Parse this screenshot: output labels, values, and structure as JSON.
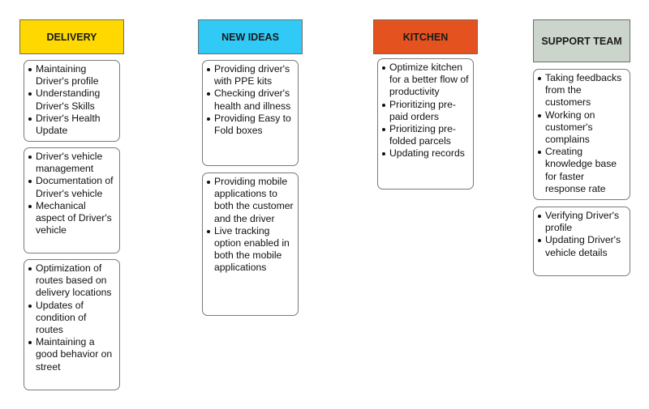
{
  "columns": [
    {
      "title": "DELIVERY",
      "color": "#ffd800",
      "cards": [
        {
          "items": [
            "Maintaining Driver's profile",
            "Understanding Driver's Skills",
            "Driver's Health Update"
          ]
        },
        {
          "items": [
            "Driver's vehicle management",
            "Documentation of Driver's vehicle",
            "Mechanical aspect of Driver's vehicle"
          ]
        },
        {
          "items": [
            "Optimization of routes based on delivery locations",
            "Updates of condition of routes",
            "Maintaining a good behavior on street"
          ]
        }
      ]
    },
    {
      "title": "NEW IDEAS",
      "color": "#31c9f5",
      "cards": [
        {
          "items": [
            "Providing driver's with PPE kits",
            "Checking driver's health and illness",
            "Providing Easy to Fold boxes"
          ]
        },
        {
          "items": [
            "Providing mobile applications to both the customer and the driver",
            "Live tracking option enabled in both the mobile applications"
          ]
        }
      ]
    },
    {
      "title": "KITCHEN",
      "color": "#e4521f",
      "cards": [
        {
          "items": [
            "Optimize kitchen for a better flow of productivity",
            "Prioritizing pre-paid orders",
            "Prioritizing pre-folded parcels",
            "Updating records"
          ]
        }
      ]
    },
    {
      "title": "SUPPORT TEAM",
      "color": "#cbd5cc",
      "cards": [
        {
          "items": [
            "Taking feedbacks from the customers",
            "Working on customer's complains",
            "Creating knowledge base for faster response rate"
          ]
        },
        {
          "items": [
            "Verifying Driver's profile",
            "Updating Driver's vehicle details"
          ]
        }
      ]
    }
  ]
}
